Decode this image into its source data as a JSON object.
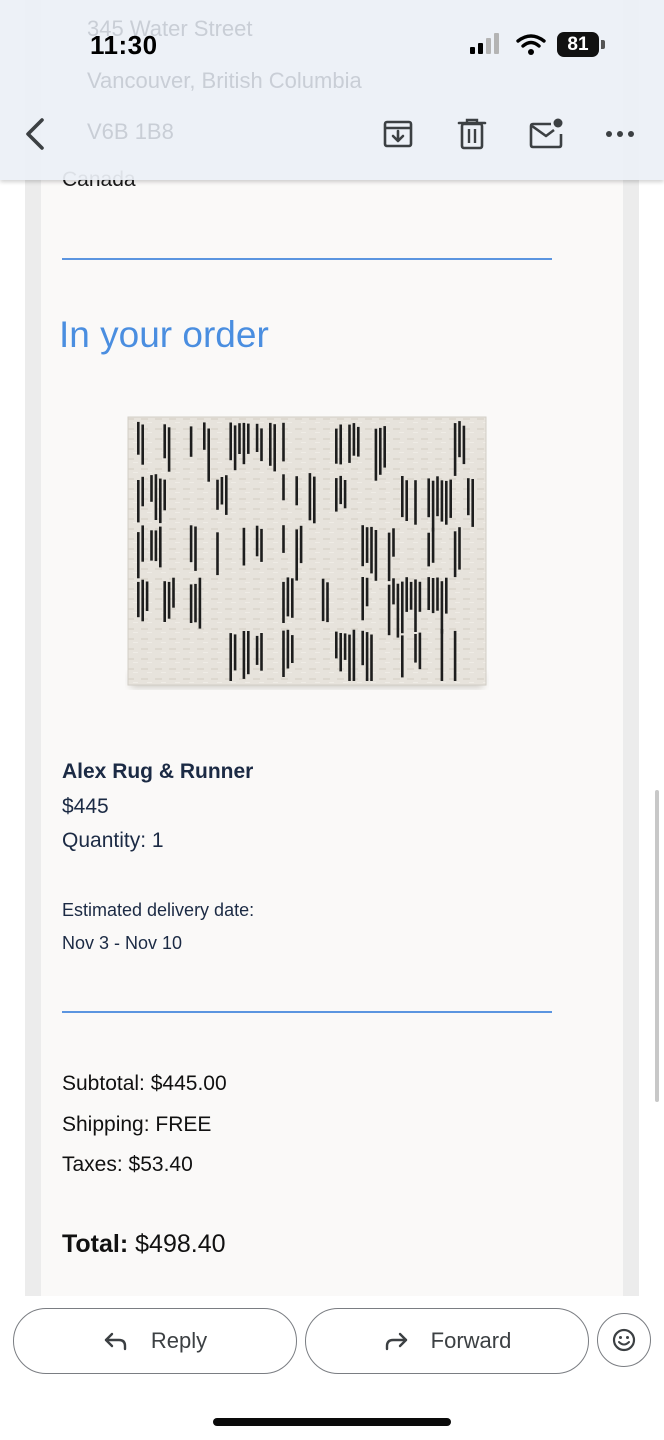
{
  "status_bar": {
    "time": "11:30",
    "battery": "81"
  },
  "email": {
    "address_partial": [
      "345 Water Street",
      "Vancouver, British Columbia",
      "V6B 1B8",
      "Canada"
    ],
    "section_title": "In your order",
    "product": {
      "name": "Alex Rug & Runner",
      "price": "$445",
      "quantity": "Quantity: 1",
      "delivery_label": "Estimated delivery date:",
      "delivery_value": "Nov 3 - Nov 10",
      "image_icon": "rug-image"
    },
    "summary": {
      "subtotal": "Subtotal: $445.00",
      "shipping": "Shipping: FREE",
      "taxes": "Taxes: $53.40",
      "total_label": "Total:",
      "total_value": "$498.40"
    }
  },
  "header_icons": [
    "back-icon",
    "archive-icon",
    "delete-icon",
    "mark-unread-icon",
    "more-icon"
  ],
  "actions": {
    "reply": "Reply",
    "forward": "Forward"
  },
  "colors": {
    "accent_blue": "#4a8ee0",
    "divider_blue": "#5b95e0",
    "product_text": "#1b2a44"
  }
}
